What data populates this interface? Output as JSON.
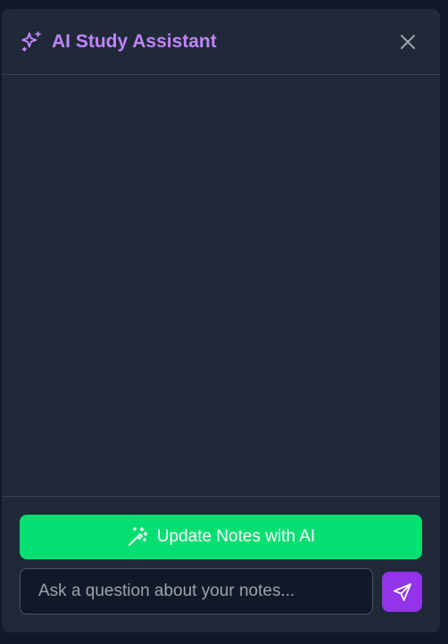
{
  "header": {
    "title": "AI Study Assistant",
    "title_icon": "sparkles-icon",
    "close_icon": "close-icon"
  },
  "messages": [],
  "footer": {
    "update_button_label": "Update Notes with AI",
    "update_button_icon": "magic-wand-icon",
    "input_placeholder": "Ask a question about your notes...",
    "input_value": "",
    "send_icon": "send-icon"
  },
  "colors": {
    "background": "#111827",
    "panel": "#1f2937",
    "accent_purple": "#c084fc",
    "send_button": "#9333ea",
    "update_button": "#05df72",
    "border": "#374151"
  }
}
